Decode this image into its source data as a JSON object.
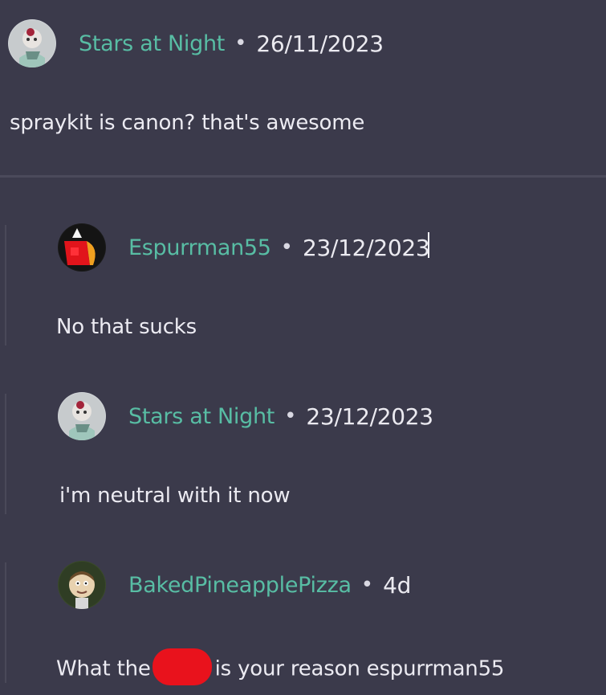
{
  "comments": [
    {
      "username": "Stars at Night",
      "separator": "•",
      "date": "26/11/2023",
      "text": "spraykit is canon? that's awesome",
      "avatar": "character-avatar"
    },
    {
      "username": "Espurrman55",
      "separator": "•",
      "date": "23/12/2023",
      "text": "No that sucks",
      "avatar": "red-character-avatar"
    },
    {
      "username": "Stars at Night",
      "separator": "•",
      "date": "23/12/2023",
      "text": "i'm neutral with it now",
      "avatar": "character-avatar"
    },
    {
      "username": "BakedPineapplePizza",
      "separator": "•",
      "date": "4d",
      "text_before": "What the",
      "text_after": "is your reason espurrman55",
      "avatar": "cartoon-face-avatar"
    }
  ],
  "colors": {
    "background": "#3b3a4b",
    "username": "#58bda4",
    "text": "#ebeaf0",
    "censor": "#e9121c"
  }
}
